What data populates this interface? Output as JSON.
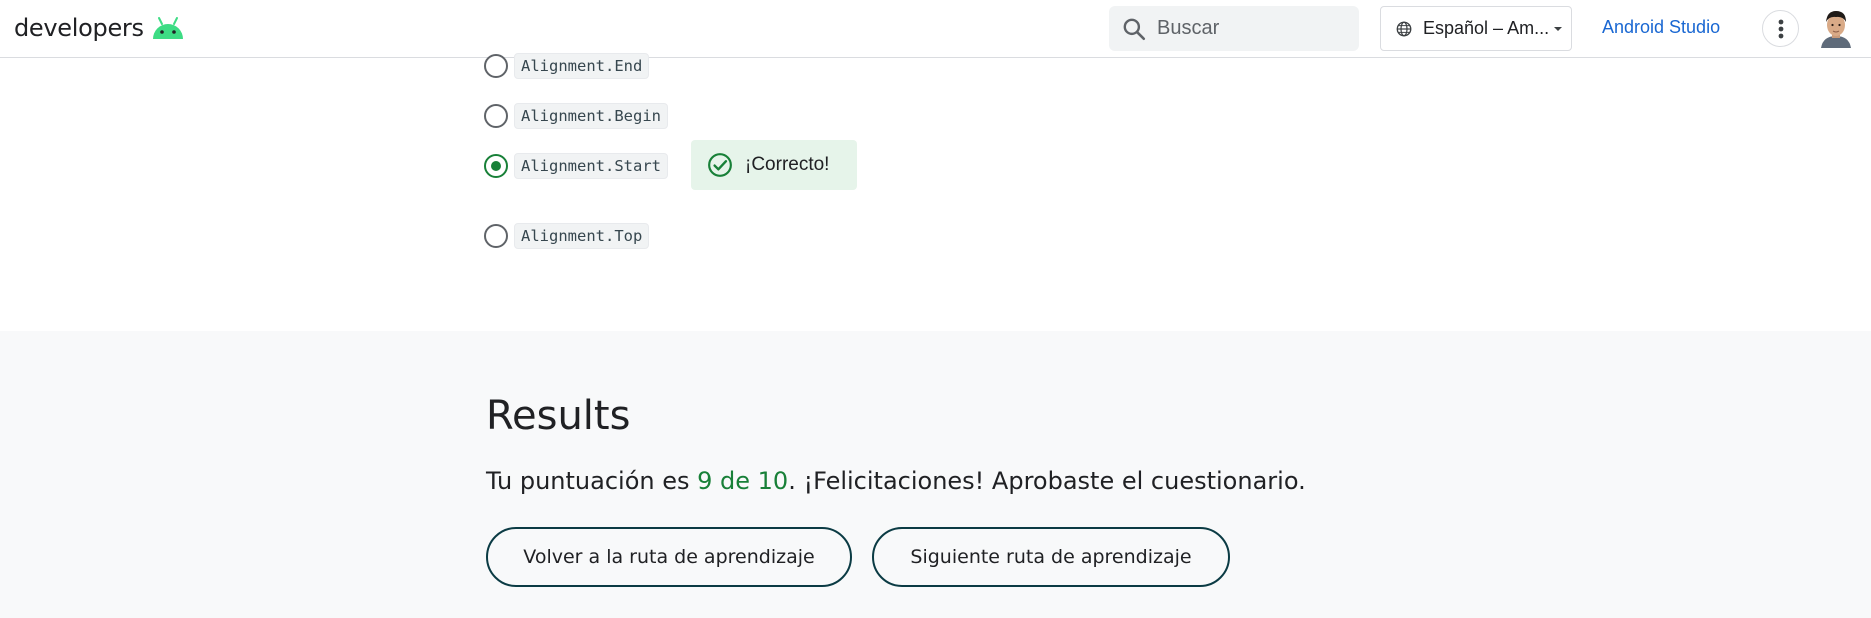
{
  "header": {
    "logo_text": "developers",
    "logo_icon": "android-bot-icon",
    "search_placeholder": "Buscar",
    "language_label": "Español – Am...",
    "studio_link": "Android Studio",
    "brand_color": "#3ddc84",
    "link_color": "#1967d2"
  },
  "quiz": {
    "options": [
      {
        "label": "Alignment.End",
        "selected": false
      },
      {
        "label": "Alignment.Begin",
        "selected": false
      },
      {
        "label": "Alignment.Start",
        "selected": true
      },
      {
        "label": "Alignment.Top",
        "selected": false
      }
    ],
    "feedback": "¡Correcto!",
    "correct_color": "#188038"
  },
  "results": {
    "title": "Results",
    "score_prefix": "Tu puntuación es ",
    "score_value": "9 de 10",
    "score_suffix": ". ¡Felicitaciones! Aprobaste el cuestionario.",
    "back_button": "Volver a la ruta de aprendizaje",
    "next_button": "Siguiente ruta de aprendizaje"
  }
}
